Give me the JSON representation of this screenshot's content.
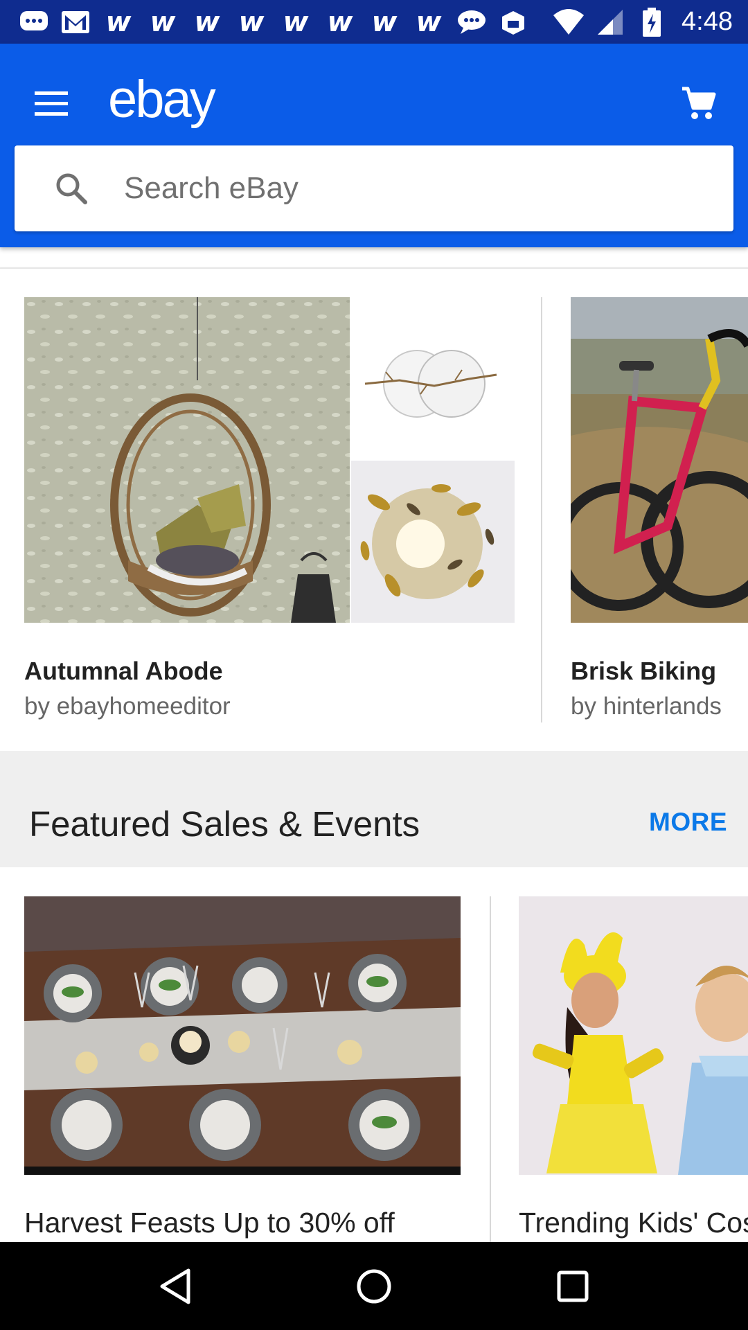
{
  "status_bar": {
    "time": "4:48",
    "left_icons": [
      "chat-bubble-icon",
      "gmail-icon",
      "w-icon",
      "w-icon",
      "w-icon",
      "w-icon",
      "w-icon",
      "w-icon",
      "w-icon",
      "w-icon",
      "message-bubble-icon",
      "box-app-icon"
    ],
    "w_glyph": "w",
    "right_icons": [
      "wifi-icon",
      "signal-icon",
      "battery-charging-icon"
    ]
  },
  "app_bar": {
    "logo_text": "ebay",
    "menu_icon": "hamburger-menu-icon",
    "cart_icon": "shopping-cart-icon",
    "search": {
      "placeholder": "Search eBay",
      "value": ""
    }
  },
  "collections": [
    {
      "title": "Autumnal Abode",
      "subtitle": "by ebayhomeeditor"
    },
    {
      "title": "Brisk Biking",
      "subtitle": "by hinterlands"
    }
  ],
  "featured": {
    "title": "Featured Sales & Events",
    "more_label": "MORE",
    "events": [
      {
        "title": "Harvest Feasts Up to 30% off"
      },
      {
        "title": "Trending Kids' Costumes"
      }
    ]
  },
  "nav_bar": {
    "icons": [
      "back-triangle-icon",
      "home-circle-icon",
      "recents-square-icon"
    ]
  },
  "colors": {
    "status_bar": "#0f2c8f",
    "app_bar": "#0b5ce8",
    "more_link": "#0b79e8",
    "section_bg": "#efefef"
  }
}
